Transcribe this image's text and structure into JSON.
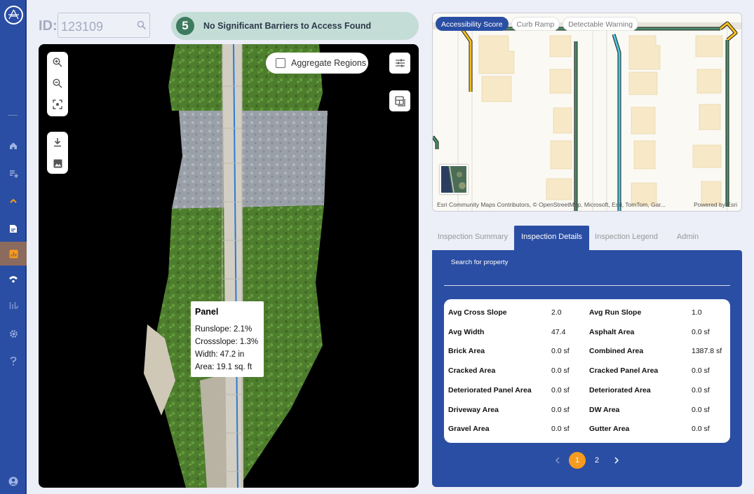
{
  "header": {
    "id_label": "ID:",
    "id_value": "123109",
    "banner_number": "5",
    "banner_text": "No Significant Barriers to Access Found"
  },
  "viewer": {
    "aggregate_label": "Aggregate Regions",
    "aggregate_checked": false,
    "tooltip": {
      "title": "Panel",
      "lines": [
        "Runslope:  2.1%",
        "Crossslope:  1.3%",
        "Width:  47.2 in",
        "Area:  19.1 sq. ft"
      ]
    }
  },
  "map": {
    "tabs": [
      {
        "label": "Accessibility Score",
        "active": true
      },
      {
        "label": "Curb Ramp",
        "active": false
      },
      {
        "label": "Detectable Warning",
        "active": false
      }
    ],
    "attribution": "Esri Community Maps Contributors, © OpenStreetMap, Microsoft, Esri, TomTom, Gar...",
    "powered_by": "Powered by Esri"
  },
  "tabs": [
    {
      "label": "Inspection Summary",
      "active": false
    },
    {
      "label": "Inspection Details",
      "active": true
    },
    {
      "label": "Inspection Legend",
      "active": false
    },
    {
      "label": "Admin",
      "active": false
    }
  ],
  "details": {
    "search_label": "Search for property",
    "rows": [
      {
        "k1": "Avg Cross Slope",
        "v1": "2.0",
        "k2": "Avg Run Slope",
        "v2": "1.0"
      },
      {
        "k1": "Avg Width",
        "v1": "47.4",
        "k2": "Asphalt Area",
        "v2": "0.0 sf"
      },
      {
        "k1": "Brick Area",
        "v1": "0.0 sf",
        "k2": "Combined Area",
        "v2": "1387.8 sf"
      },
      {
        "k1": "Cracked Area",
        "v1": "0.0 sf",
        "k2": "Cracked Panel Area",
        "v2": "0.0 sf"
      },
      {
        "k1": "Deteriorated Panel Area",
        "v1": "0.0 sf",
        "k2": "Deteriorated Area",
        "v2": "0.0 sf"
      },
      {
        "k1": "Driveway Area",
        "v1": "0.0 sf",
        "k2": "DW Area",
        "v2": "0.0 sf"
      },
      {
        "k1": "Gravel Area",
        "v1": "0.0 sf",
        "k2": "Gutter Area",
        "v2": "0.0 sf"
      }
    ],
    "pages": [
      "1",
      "2"
    ],
    "current_page": "1",
    "prev_icon": "chevron-left-icon",
    "next_icon": "chevron-right-icon"
  },
  "colors": {
    "brand": "#2a4ea3",
    "accent": "#f59b1f",
    "success": "#3d7a5e",
    "banner_bg": "#c4ddd7"
  }
}
